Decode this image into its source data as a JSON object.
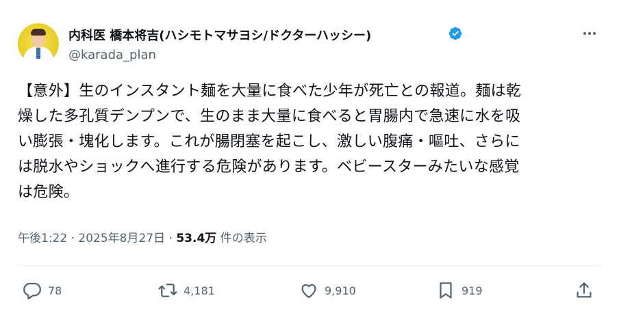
{
  "author": {
    "name": "内科医 橋本将吉(ハシモトマサヨシ/ドクターハッシー)",
    "handle": "@karada_plan",
    "verified": true
  },
  "tweet": {
    "text": "【意外】生のインスタント麺を大量に食べた少年が死亡との報道。麺は乾\n燥した多孔質デンプンで、生のまま大量に食べると胃腸内で急速に水を吸\nい膨張・塊化します。これが腸閉塞を起こし、激しい腹痛・嘔吐、さらに\nは脱水やショックへ進行する危険があります。ベビースターみたいな感覚\nは危険。"
  },
  "meta": {
    "time": "午後1:22",
    "date": "2025年8月27日",
    "separator": "·",
    "views": "53.4万",
    "views_label": "件の表示"
  },
  "actions": {
    "replies": "78",
    "reposts": "4,181",
    "likes": "9,910",
    "bookmarks": "919"
  },
  "colors": {
    "text": "#0f1419",
    "secondary": "#536471",
    "verified": "#1d9bf0",
    "divider": "#eff3f4"
  },
  "icons": [
    "verified-badge-icon",
    "more-icon",
    "reply-icon",
    "repost-icon",
    "like-icon",
    "bookmark-icon",
    "share-icon"
  ]
}
